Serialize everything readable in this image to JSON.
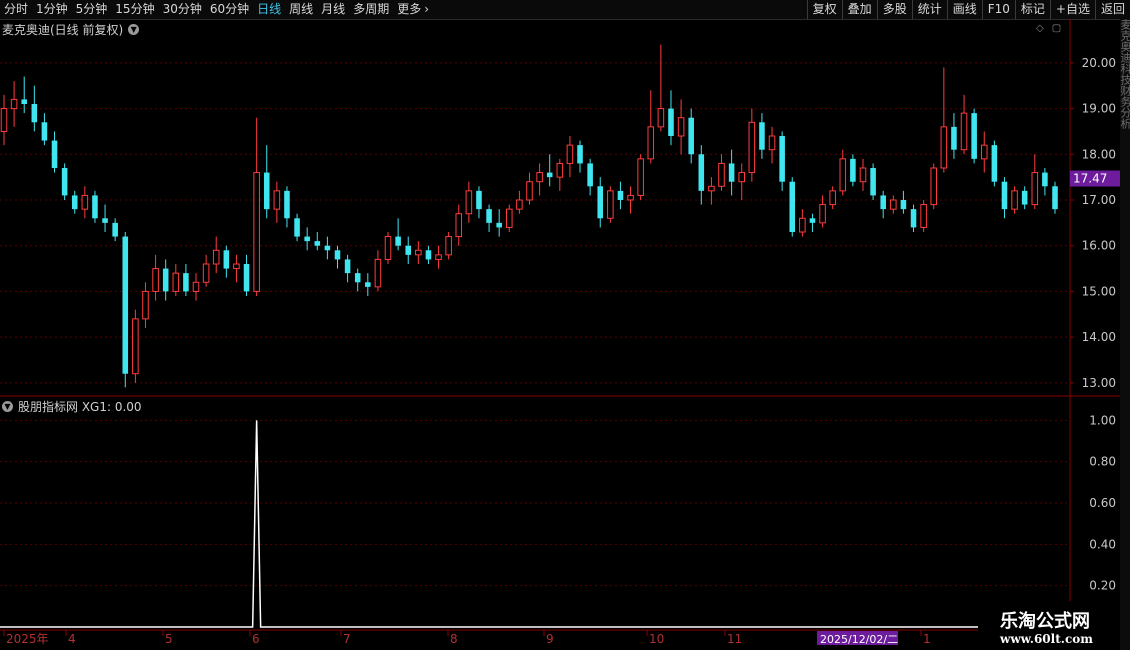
{
  "toolbar": {
    "periods": [
      "分时",
      "1分钟",
      "5分钟",
      "15分钟",
      "30分钟",
      "60分钟",
      "日线",
      "周线",
      "月线",
      "多周期",
      "更多"
    ],
    "active_period": "日线",
    "more_arrow": "›",
    "actions": [
      "复权",
      "叠加",
      "多股",
      "统计",
      "画线",
      "F10",
      "标记",
      "+自选",
      "返回"
    ]
  },
  "main_chart": {
    "title": "麦克奥迪(日线 前复权)",
    "title_icon": "chevron-down-icon",
    "current_price": "17.47",
    "price_ticks": [
      "20.00",
      "19.00",
      "18.00",
      "17.00",
      "16.00",
      "15.00",
      "14.00",
      "13.00"
    ]
  },
  "indicator": {
    "title": "股朋指标网 XG1: 0.00",
    "ticks": [
      "1.00",
      "0.80",
      "0.60",
      "0.40",
      "0.20"
    ]
  },
  "x_axis": {
    "labels": [
      "2025年",
      "4",
      "5",
      "6",
      "7",
      "8",
      "9",
      "10",
      "11",
      "1"
    ],
    "cursor_date": "2025/12/02/二"
  },
  "right_panel_text": "麦克奥迪科技财务分析",
  "watermark": {
    "line1": "乐淘公式网",
    "line2": "www.60lt.com"
  },
  "colors": {
    "up": "#ff3c3c",
    "down": "#3fe6f0",
    "grid": "#5a0000",
    "axis_text": "#c8c8c8",
    "price_badge": "#6c1c9c",
    "date_badge": "#6c1c9c"
  },
  "chart_data": {
    "type": "candlestick",
    "ylim": [
      12.8,
      20.5
    ],
    "ohlc": [
      [
        18.5,
        19.3,
        18.2,
        19.0
      ],
      [
        19.0,
        19.6,
        18.6,
        19.2
      ],
      [
        19.2,
        19.7,
        18.9,
        19.1
      ],
      [
        19.1,
        19.5,
        18.5,
        18.7
      ],
      [
        18.7,
        18.9,
        18.2,
        18.3
      ],
      [
        18.3,
        18.5,
        17.6,
        17.7
      ],
      [
        17.7,
        17.8,
        17.0,
        17.1
      ],
      [
        17.1,
        17.2,
        16.7,
        16.8
      ],
      [
        16.8,
        17.3,
        16.6,
        17.1
      ],
      [
        17.1,
        17.2,
        16.5,
        16.6
      ],
      [
        16.6,
        16.9,
        16.3,
        16.5
      ],
      [
        16.5,
        16.6,
        16.1,
        16.2
      ],
      [
        16.2,
        16.3,
        12.9,
        13.2
      ],
      [
        13.2,
        14.6,
        13.0,
        14.4
      ],
      [
        14.4,
        15.2,
        14.2,
        15.0
      ],
      [
        15.0,
        15.8,
        14.8,
        15.5
      ],
      [
        15.5,
        15.7,
        14.8,
        15.0
      ],
      [
        15.0,
        15.6,
        14.9,
        15.4
      ],
      [
        15.4,
        15.6,
        14.9,
        15.0
      ],
      [
        15.0,
        15.4,
        14.8,
        15.2
      ],
      [
        15.2,
        15.8,
        15.1,
        15.6
      ],
      [
        15.6,
        16.2,
        15.4,
        15.9
      ],
      [
        15.9,
        16.0,
        15.3,
        15.5
      ],
      [
        15.5,
        15.8,
        15.2,
        15.6
      ],
      [
        15.6,
        15.8,
        14.9,
        15.0
      ],
      [
        15.0,
        18.8,
        14.9,
        17.6
      ],
      [
        17.6,
        18.2,
        16.6,
        16.8
      ],
      [
        16.8,
        17.4,
        16.5,
        17.2
      ],
      [
        17.2,
        17.3,
        16.4,
        16.6
      ],
      [
        16.6,
        16.7,
        16.1,
        16.2
      ],
      [
        16.2,
        16.4,
        15.9,
        16.1
      ],
      [
        16.1,
        16.3,
        15.9,
        16.0
      ],
      [
        16.0,
        16.2,
        15.7,
        15.9
      ],
      [
        15.9,
        16.0,
        15.5,
        15.7
      ],
      [
        15.7,
        15.8,
        15.2,
        15.4
      ],
      [
        15.4,
        15.5,
        15.0,
        15.2
      ],
      [
        15.2,
        15.4,
        14.9,
        15.1
      ],
      [
        15.1,
        15.9,
        15.0,
        15.7
      ],
      [
        15.7,
        16.3,
        15.6,
        16.2
      ],
      [
        16.2,
        16.6,
        15.9,
        16.0
      ],
      [
        16.0,
        16.2,
        15.6,
        15.8
      ],
      [
        15.8,
        16.1,
        15.6,
        15.9
      ],
      [
        15.9,
        16.0,
        15.6,
        15.7
      ],
      [
        15.7,
        16.0,
        15.5,
        15.8
      ],
      [
        15.8,
        16.3,
        15.7,
        16.2
      ],
      [
        16.2,
        16.9,
        16.0,
        16.7
      ],
      [
        16.7,
        17.4,
        16.5,
        17.2
      ],
      [
        17.2,
        17.3,
        16.6,
        16.8
      ],
      [
        16.8,
        16.9,
        16.3,
        16.5
      ],
      [
        16.5,
        16.8,
        16.2,
        16.4
      ],
      [
        16.4,
        16.9,
        16.3,
        16.8
      ],
      [
        16.8,
        17.2,
        16.7,
        17.0
      ],
      [
        17.0,
        17.6,
        16.9,
        17.4
      ],
      [
        17.4,
        17.8,
        17.1,
        17.6
      ],
      [
        17.6,
        18.0,
        17.3,
        17.5
      ],
      [
        17.5,
        17.9,
        17.2,
        17.8
      ],
      [
        17.8,
        18.4,
        17.5,
        18.2
      ],
      [
        18.2,
        18.3,
        17.6,
        17.8
      ],
      [
        17.8,
        17.9,
        17.1,
        17.3
      ],
      [
        17.3,
        17.5,
        16.4,
        16.6
      ],
      [
        16.6,
        17.3,
        16.5,
        17.2
      ],
      [
        17.2,
        17.4,
        16.8,
        17.0
      ],
      [
        17.0,
        17.3,
        16.7,
        17.1
      ],
      [
        17.1,
        18.0,
        17.0,
        17.9
      ],
      [
        17.9,
        19.4,
        17.8,
        18.6
      ],
      [
        18.6,
        20.4,
        18.5,
        19.0
      ],
      [
        19.0,
        19.4,
        18.2,
        18.4
      ],
      [
        18.4,
        19.2,
        18.0,
        18.8
      ],
      [
        18.8,
        19.0,
        17.8,
        18.0
      ],
      [
        18.0,
        18.2,
        16.9,
        17.2
      ],
      [
        17.2,
        17.5,
        16.9,
        17.3
      ],
      [
        17.3,
        18.0,
        17.2,
        17.8
      ],
      [
        17.8,
        18.1,
        17.1,
        17.4
      ],
      [
        17.4,
        17.8,
        17.0,
        17.6
      ],
      [
        17.6,
        19.0,
        17.4,
        18.7
      ],
      [
        18.7,
        18.9,
        17.9,
        18.1
      ],
      [
        18.1,
        18.6,
        17.8,
        18.4
      ],
      [
        18.4,
        18.5,
        17.2,
        17.4
      ],
      [
        17.4,
        17.5,
        16.2,
        16.3
      ],
      [
        16.3,
        16.8,
        16.2,
        16.6
      ],
      [
        16.6,
        16.7,
        16.3,
        16.5
      ],
      [
        16.5,
        17.1,
        16.4,
        16.9
      ],
      [
        16.9,
        17.3,
        16.8,
        17.2
      ],
      [
        17.2,
        18.1,
        17.1,
        17.9
      ],
      [
        17.9,
        18.0,
        17.3,
        17.4
      ],
      [
        17.4,
        17.9,
        17.2,
        17.7
      ],
      [
        17.7,
        17.8,
        17.0,
        17.1
      ],
      [
        17.1,
        17.2,
        16.6,
        16.8
      ],
      [
        16.8,
        17.1,
        16.7,
        17.0
      ],
      [
        17.0,
        17.2,
        16.7,
        16.8
      ],
      [
        16.8,
        16.9,
        16.3,
        16.4
      ],
      [
        16.4,
        17.0,
        16.3,
        16.9
      ],
      [
        16.9,
        17.8,
        16.8,
        17.7
      ],
      [
        17.7,
        19.9,
        17.6,
        18.6
      ],
      [
        18.6,
        18.9,
        17.9,
        18.1
      ],
      [
        18.1,
        19.3,
        18.0,
        18.9
      ],
      [
        18.9,
        19.0,
        17.8,
        17.9
      ],
      [
        17.9,
        18.5,
        17.6,
        18.2
      ],
      [
        18.2,
        18.3,
        17.3,
        17.4
      ],
      [
        17.4,
        17.5,
        16.6,
        16.8
      ],
      [
        16.8,
        17.3,
        16.7,
        17.2
      ],
      [
        17.2,
        17.3,
        16.8,
        16.9
      ],
      [
        16.9,
        18.0,
        16.8,
        17.6
      ],
      [
        17.6,
        17.7,
        17.1,
        17.3
      ],
      [
        17.3,
        17.4,
        16.7,
        16.8
      ]
    ],
    "indicator_series": {
      "name": "XG1",
      "values_note_index_of_spike": 25,
      "spike_value": 1.0,
      "baseline": 0.0,
      "ylim": [
        0,
        1.05
      ]
    }
  }
}
